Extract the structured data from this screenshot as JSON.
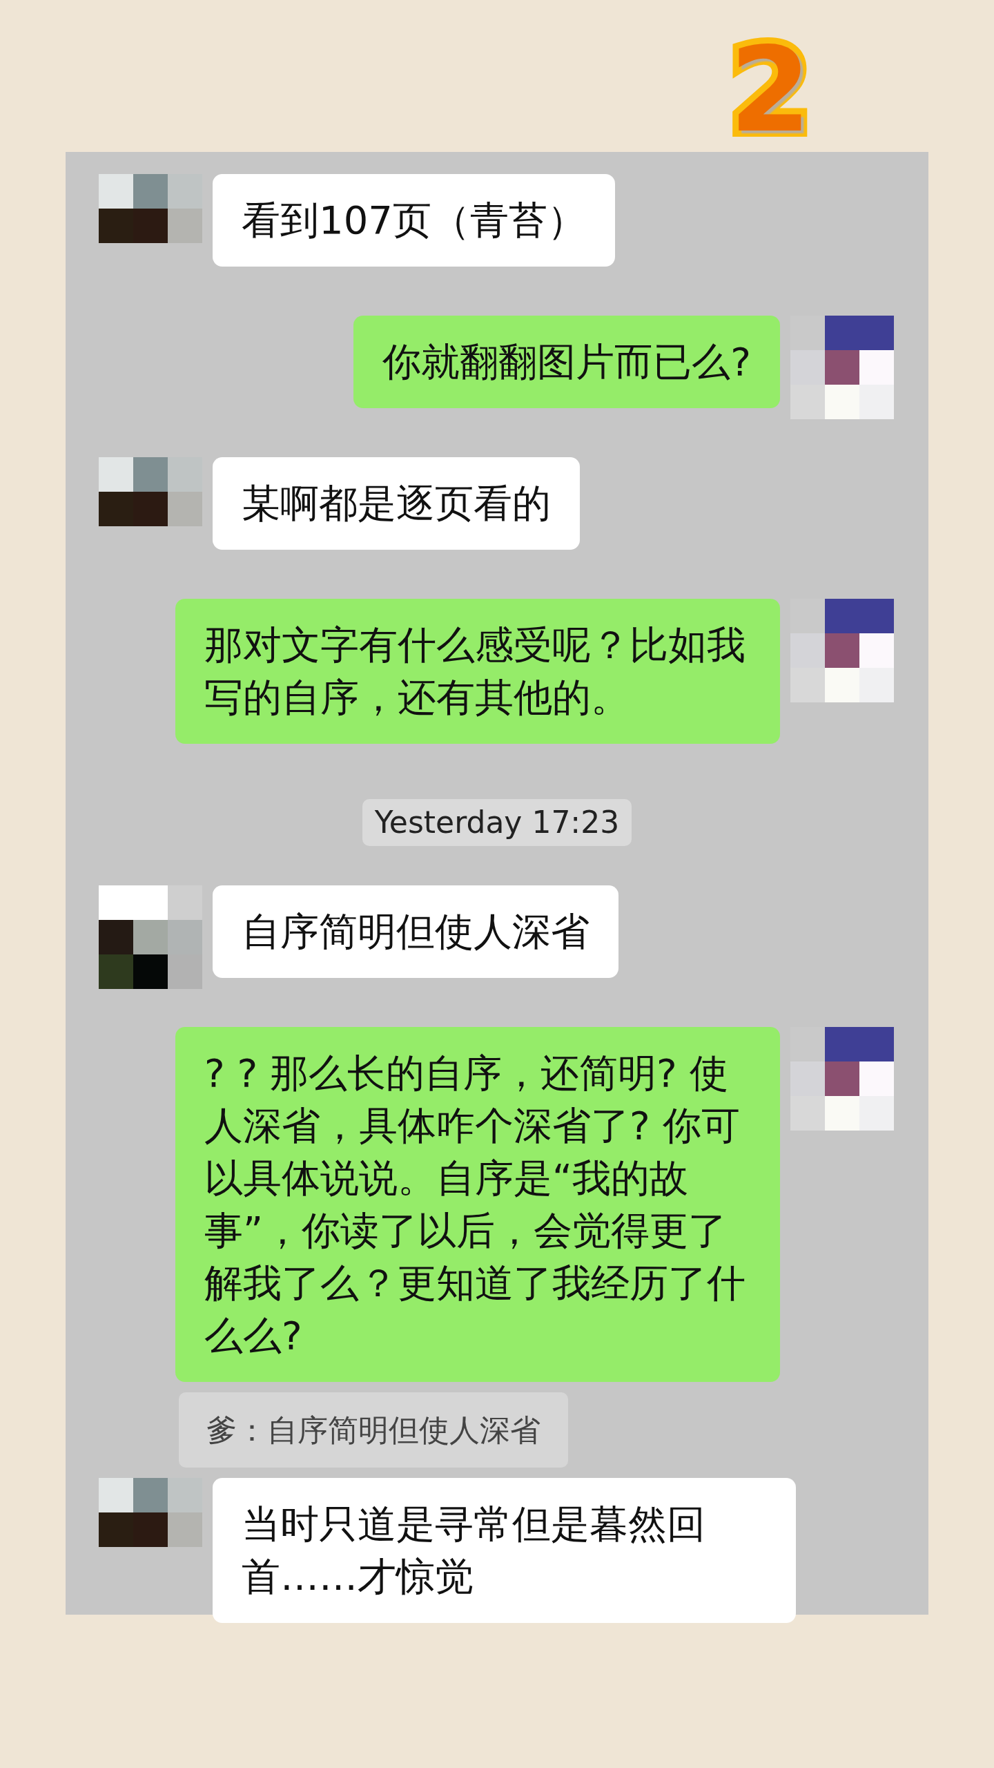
{
  "page_number": "2",
  "messages": [
    {
      "kind": "incoming",
      "text": "看到107页（青苔）"
    },
    {
      "kind": "outgoing",
      "text": "你就翻翻图片而已么?"
    },
    {
      "kind": "incoming",
      "text": "某啊都是逐页看的"
    },
    {
      "kind": "outgoing",
      "text": "那对文字有什么感受呢？比如我写的自序，还有其他的。"
    },
    {
      "kind": "timestamp",
      "text": "Yesterday 17:23"
    },
    {
      "kind": "incoming",
      "text": "自序简明但使人深省"
    },
    {
      "kind": "outgoing",
      "text": "? ?  那么长的自序，还简明? 使人深省，具体咋个深省了? 你可以具体说说。自序是“我的故事”，你读了以后，会觉得更了解我了么？更知道了我经历了什么么?"
    },
    {
      "kind": "quote",
      "text": "爹：自序简明但使人深省"
    },
    {
      "kind": "incoming",
      "text": "当时只道是寻常但是暮然回首……才惊觉"
    }
  ]
}
